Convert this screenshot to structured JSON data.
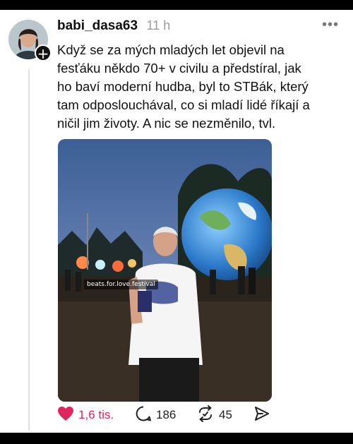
{
  "post": {
    "username": "babi_dasa63",
    "time": "11 h",
    "more_label": "•••",
    "follow_label": "+",
    "text": "Když se za mých mladých let objevil na fesťáku někdo 70+ v civilu a předstíral, jak ho baví moderní hudba, byl to STBák, který tam odposlouchával, co si mladí lidé říkají a ničil jim životy. A nic se nezměnilo, tvl.",
    "media_caption": "beats.for.love.festival"
  },
  "actions": {
    "like_count": "1,6 tis.",
    "reply_count": "186",
    "repost_count": "45"
  },
  "colors": {
    "like": "#e0245e",
    "text": "#111111",
    "muted": "#999999"
  },
  "icons": [
    "heart-icon",
    "comment-icon",
    "repost-icon",
    "share-icon",
    "more-icon",
    "plus-icon"
  ]
}
